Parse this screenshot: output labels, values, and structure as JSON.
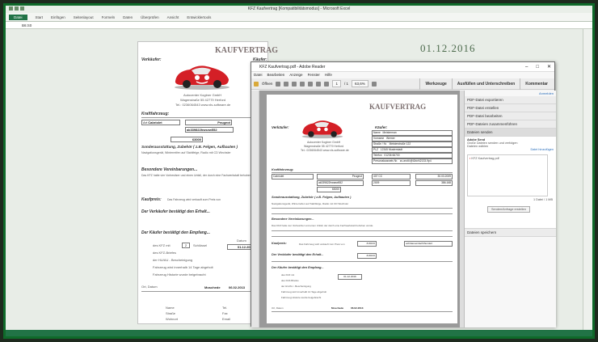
{
  "excel": {
    "title": "KFZ Kaufvertrag [Kompatibilitätsmodus] - Microsoft Excel",
    "tabs": [
      "Datei",
      "Start",
      "Einfügen",
      "Seitenlayout",
      "Formeln",
      "Daten",
      "Überprüfen",
      "Ansicht",
      "Entwicklertools"
    ],
    "name_box": "B6:S0",
    "big_date": "01.12.2016"
  },
  "sheet": {
    "title": "KAUFVERTRAG",
    "verkaeufer": "Verkäufer:",
    "kaeufer": "Käufer:",
    "seller_name": "Autocenter Kogtner GmbH",
    "seller_street": "Wagenstraße 55   42779 Herford",
    "seller_phone": "Tel.: 0236064543   www.xls-software.de",
    "kfz": "Kraftfahrzeug:",
    "type_label": "Art",
    "type_value": "Cabriolet",
    "maker_value": "Peugeot",
    "chassis": "ak339822hwsew552",
    "km": "63000",
    "extras": "Sonderausstattung, Zubehör ( z.B. Felgen, Aufbauten )",
    "extras_text": "Navigationsgerät, Winterreifen auf Stahlfelge, Radio mit CD Wechsler",
    "vereinb": "Besondere Vereinbarungen...",
    "vereinb_text": "Das KFZ hatte vier Vorbesitzer und einen Unfall, der durch eine Fachwerkstatt behoben wurde.",
    "kaufpreis": "Kaufpreis:",
    "kaufpreis_note": "Das Fahrzeug wird verkauft zum Preis von",
    "bestaetigt": "Der Verkäufer bestätigt den Erhalt...",
    "empfang": "Der Käufer bestätigt den Empfang...",
    "datum": "Datum",
    "date_value": "01.12.2016",
    "zweite": "2",
    "schluessel": "Schlüssel",
    "items": [
      "des KFZ mit",
      "des KFZ-Briefes",
      "der HU/AU - Bescheinigung",
      "Fahrzeug wird innerhalb 14 Tage abgeholt",
      "Fahrzeug Historie wurde beigebracht"
    ],
    "ort": "Ort, Datum",
    "signed_place": "Moschede",
    "signed_date": "06.02.2013",
    "footer_labels": [
      "Name",
      "Straße",
      "Wohnort"
    ],
    "footer_labels_r": [
      "Tel.",
      "Fax",
      "Email"
    ]
  },
  "reader": {
    "title": "KFZ Kaufvertrag.pdf - Adobe Reader",
    "menu": [
      "Datei",
      "Bearbeiten",
      "Anzeige",
      "Fenster",
      "Hilfe"
    ],
    "open": "Öffnen",
    "page": "1",
    "pages": "/ 1",
    "zoom": "63,6%",
    "right_tabs": [
      "Werkzeuge",
      "Ausfüllen und Unterschreiben",
      "Kommentar"
    ],
    "anmelden": "Anmelden",
    "sections": [
      "PDF-Datei exportieren",
      "PDF-Datei erstellen",
      "PDF-Datei bearbeiten",
      "PDF-Dateien zusammenführen",
      "Dateien senden"
    ],
    "send_service": "Adobe Send",
    "send_text": "Große Dateien senden und verfolgen",
    "send_choose": "Dateien wählen",
    "send_add": "Datei hinzufügen",
    "file_item": "KFZ Kaufvertrag.pdf",
    "file_count": "1 Datei / 1 MB",
    "send_button": "Senden/Anfrage erstellen",
    "save_section": "Dateien speichern",
    "page_seller_name": "Autocenter Kogtner GmbH",
    "page_seller_street": "Wagenstraße 55   42779 Herford",
    "page_seller_phone": "Tel.: 0236064543   www.xls-software.de",
    "buyer_rows": [
      [
        "Name",
        "Meisterman"
      ],
      [
        "Vorname",
        "Werner"
      ],
      [
        "Straße / Nr.",
        "Meisterstraße 122"
      ],
      [
        "PLZ",
        "12345  Musterstadt"
      ],
      [
        "Telefon",
        "01236 66700"
      ],
      [
        "Personalausweis Nr.",
        "zu.andt.t@t2dcf42133-9p4"
      ]
    ],
    "kfz_row": [
      "Cabriolet",
      "Peugeot",
      "407 CC",
      "30.03.2009"
    ],
    "chassis_row": [
      "ak339822hwsew552",
      "63000",
      "2009",
      "386.168"
    ],
    "kaufpreis_value": "8.800 €",
    "kaufpreis_words": "achttausendachthundert",
    "footer": [
      "Moschede",
      "06.02.2013"
    ]
  },
  "colors": {
    "excel_green": "#217346",
    "frame_green": "#0f6a2a",
    "title_red": "#7c6f6f"
  }
}
